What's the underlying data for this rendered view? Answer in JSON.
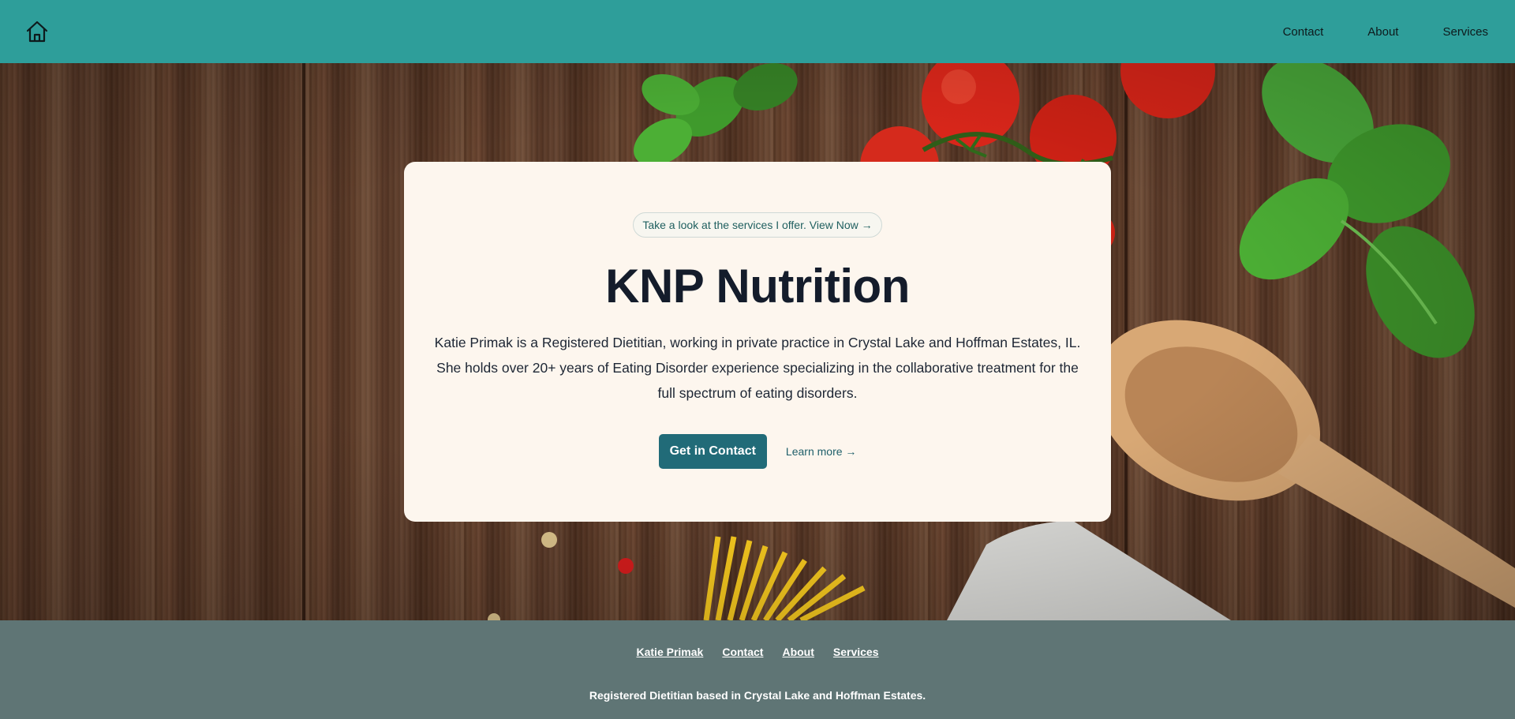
{
  "header": {
    "home_icon": "house-icon",
    "nav": [
      "Contact",
      "About",
      "Services"
    ]
  },
  "hero": {
    "pill": "Take a look at the services I offer. View Now →",
    "title": "KNP Nutrition",
    "description": "Katie Primak is a Registered Dietitian, working in private practice in Crystal Lake and Hoffman Estates, IL. She holds over 20+ years of Eating Disorder experience specializing in the collaborative treatment for the full spectrum of eating disorders.",
    "primary_button": "Get in Contact",
    "secondary_link": "Learn more →"
  },
  "footer": {
    "links": [
      "Katie Primak",
      "Contact",
      "About",
      "Services"
    ],
    "tagline": "Registered Dietitian based in Crystal Lake and Hoffman Estates."
  },
  "colors": {
    "header_bg": "#2e9e9a",
    "card_bg": "#fdf6ee",
    "primary_button": "#216b78",
    "footer_bg": "#5f7575"
  }
}
